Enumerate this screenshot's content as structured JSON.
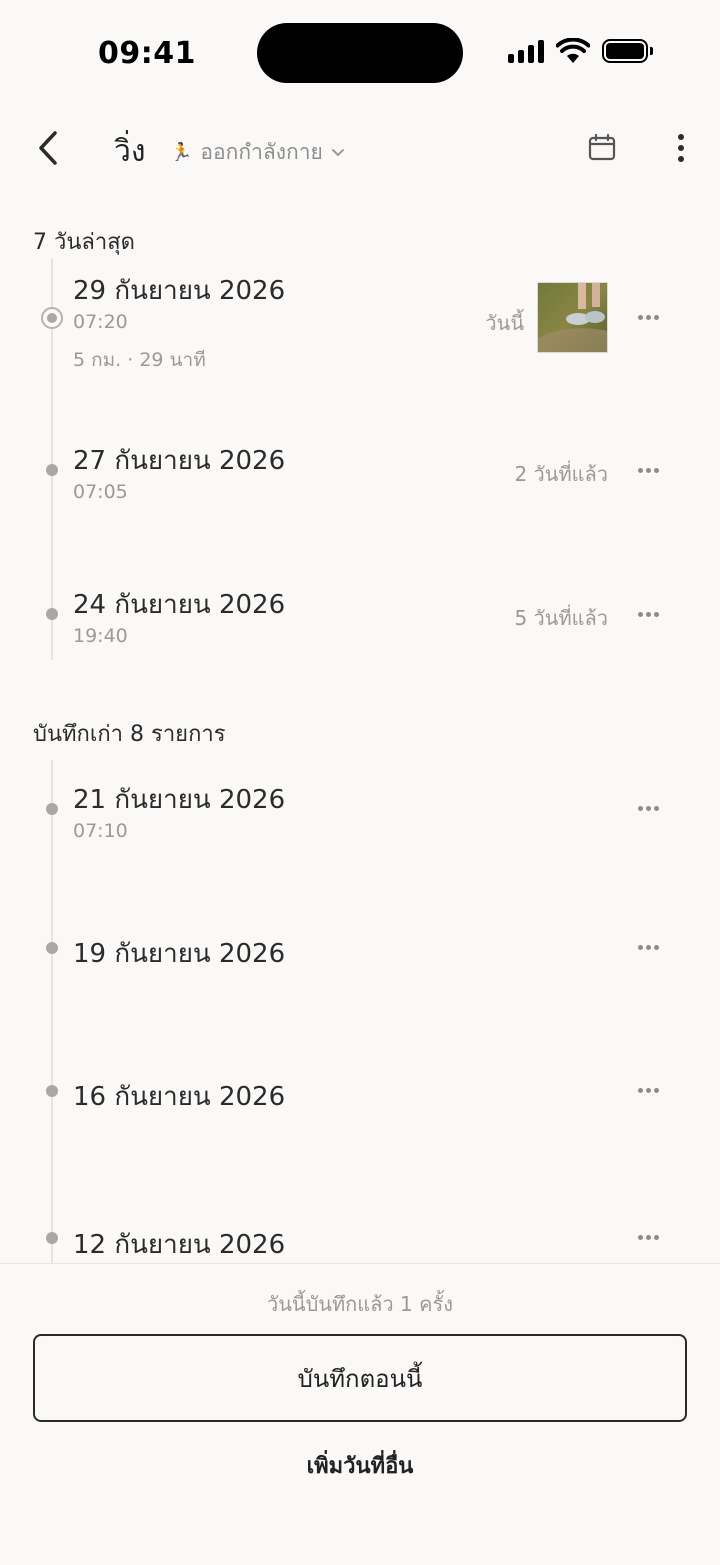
{
  "status_bar": {
    "time": "09:41"
  },
  "header": {
    "title": "วิ่ง",
    "category_emoji": "🏃",
    "category_label": "ออกกำลังกาย"
  },
  "recent": {
    "title": "7 วันล่าสุด",
    "entries": [
      {
        "date": "29 กันยายน 2026",
        "time": "07:20",
        "detail": "5 กม. · 29 นาที",
        "relative": "วันนี้",
        "has_photo": true
      },
      {
        "date": "27 กันยายน 2026",
        "time": "07:05",
        "relative": "2 วันที่แล้ว"
      },
      {
        "date": "24 กันยายน 2026",
        "time": "19:40",
        "relative": "5 วันที่แล้ว"
      }
    ]
  },
  "older": {
    "title": "บันทึกเก่า 8 รายการ",
    "entries": [
      {
        "date": "21 กันยายน 2026",
        "time": "07:10"
      },
      {
        "date": "19 กันยายน 2026"
      },
      {
        "date": "16 กันยายน 2026"
      },
      {
        "date": "12 กันยายน 2026"
      }
    ]
  },
  "bottom": {
    "status": "วันนี้บันทึกแล้ว 1 ครั้ง",
    "log_now_label": "บันทึกตอนนี้",
    "add_other_label": "เพิ่มวันที่อื่น"
  },
  "colors": {
    "background": "#faf9f7",
    "text": "#2b2b2b",
    "muted": "#9b9a97"
  }
}
